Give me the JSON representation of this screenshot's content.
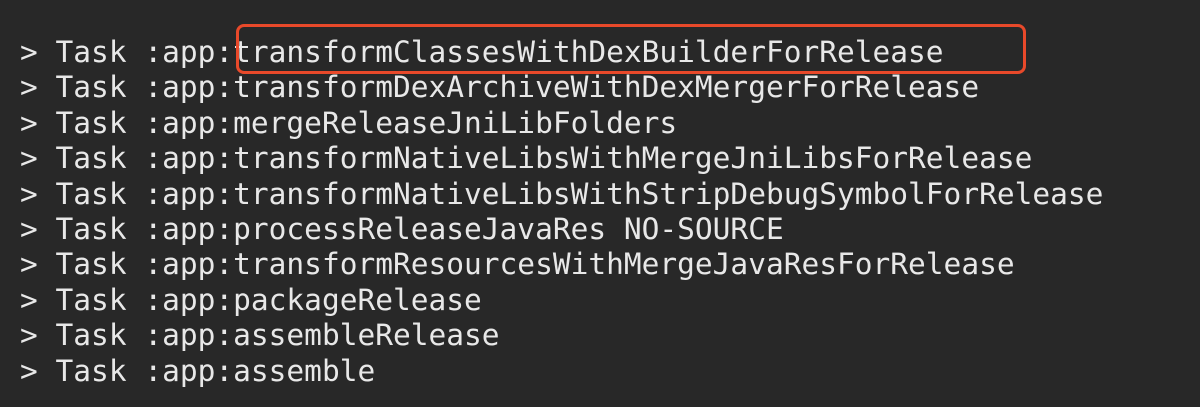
{
  "terminal": {
    "prompt_symbol": ">",
    "lines": [
      {
        "label": "Task :app:",
        "task": "transformClassesWithDexBuilderForRelease"
      },
      {
        "label": "Task :app:",
        "task": "transformDexArchiveWithDexMergerForRelease"
      },
      {
        "label": "Task :app:",
        "task": "mergeReleaseJniLibFolders"
      },
      {
        "label": "Task :app:",
        "task": "transformNativeLibsWithMergeJniLibsForRelease"
      },
      {
        "label": "Task :app:",
        "task": "transformNativeLibsWithStripDebugSymbolForRelease"
      },
      {
        "label": "Task :app:",
        "task": "processReleaseJavaRes NO-SOURCE"
      },
      {
        "label": "Task :app:",
        "task": "transformResourcesWithMergeJavaResForRelease"
      },
      {
        "label": "Task :app:",
        "task": "packageRelease"
      },
      {
        "label": "Task :app:",
        "task": "assembleRelease"
      },
      {
        "label": "Task :app:",
        "task": "assemble"
      }
    ]
  },
  "colors": {
    "background": "#282828",
    "text": "#e8e8e8",
    "highlight": "#e8492a"
  }
}
